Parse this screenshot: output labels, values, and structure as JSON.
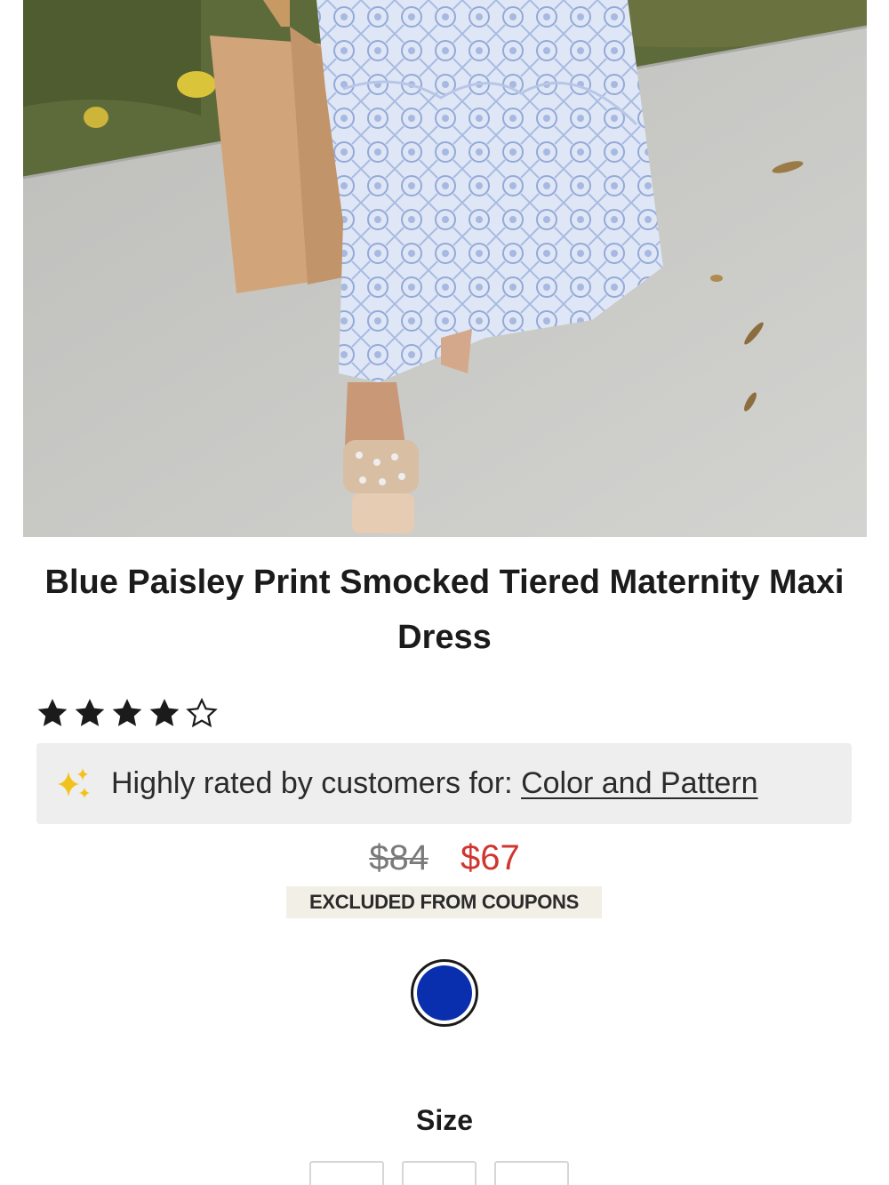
{
  "product": {
    "image_alt": "product-photo",
    "title": "Blue Paisley Print Smocked Tiered Maternity Maxi Dress",
    "rating": {
      "value": 4,
      "max": 5
    },
    "highlight": {
      "icon": "sparkle-icon",
      "text": "Highly rated by customers for: ",
      "link": "Color and Pattern"
    },
    "price": {
      "original": "$84",
      "sale": "$67"
    },
    "coupon_badge": "EXCLUDED FROM COUPONS",
    "colors": [
      {
        "name": "blue",
        "hex": "#0a2fae",
        "selected": true
      }
    ],
    "size_label": "Size",
    "size_options_visible": 3
  },
  "theme": {
    "sale_color": "#d0362f",
    "star_color": "#1b1b1b",
    "sparkle_color": "#f2c21b"
  }
}
